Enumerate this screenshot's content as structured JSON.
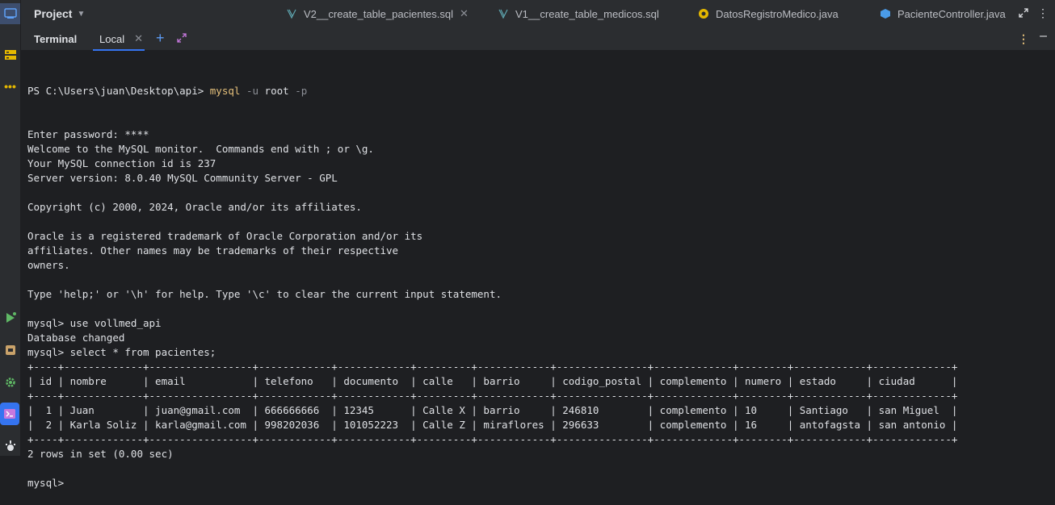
{
  "topbar": {
    "project_label": "Project",
    "tabs": [
      {
        "label": "V2__create_table_pacientes.sql",
        "icon": "sql-migration-icon",
        "closable": true
      },
      {
        "label": "V1__create_table_medicos.sql",
        "icon": "sql-migration-icon",
        "closable": false
      },
      {
        "label": "DatosRegistroMedico.java",
        "icon": "java-record-icon",
        "closable": false
      },
      {
        "label": "PacienteController.java",
        "icon": "java-class-icon",
        "closable": false
      }
    ]
  },
  "terminal_panel": {
    "title": "Terminal",
    "tab_label": "Local"
  },
  "terminal": {
    "prompt_line": {
      "prefix": "PS C:\\Users\\juan\\Desktop\\api> ",
      "command": "mysql",
      "flag1": "-u",
      "user": "root",
      "flag2": "-p"
    },
    "lines": [
      "Enter password: ****",
      "Welcome to the MySQL monitor.  Commands end with ; or \\g.",
      "Your MySQL connection id is 237",
      "Server version: 8.0.40 MySQL Community Server - GPL",
      "",
      "Copyright (c) 2000, 2024, Oracle and/or its affiliates.",
      "",
      "Oracle is a registered trademark of Oracle Corporation and/or its",
      "affiliates. Other names may be trademarks of their respective",
      "owners.",
      "",
      "Type 'help;' or '\\h' for help. Type '\\c' to clear the current input statement.",
      "",
      "mysql> use vollmed_api",
      "Database changed",
      "mysql> select * from pacientes;",
      "+----+-------------+-----------------+------------+------------+---------+------------+---------------+-------------+--------+------------+-------------+",
      "| id | nombre      | email           | telefono   | documento  | calle   | barrio     | codigo_postal | complemento | numero | estado     | ciudad      |",
      "+----+-------------+-----------------+------------+------------+---------+------------+---------------+-------------+--------+------------+-------------+",
      "|  1 | Juan        | juan@gmail.com  | 666666666  | 12345      | Calle X | barrio     | 246810        | complemento | 10     | Santiago   | san Miguel  |",
      "|  2 | Karla Soliz | karla@gmail.com | 998202036  | 101052223  | Calle Z | miraflores | 296633        | complemento | 16     | antofagsta | san antonio |",
      "+----+-------------+-----------------+------------+------------+---------+------------+---------------+-------------+--------+------------+-------------+",
      "2 rows in set (0.00 sec)",
      "",
      "mysql>"
    ]
  },
  "colors": {
    "background": "#1e1f22",
    "chrome": "#2b2d30",
    "accent": "#3574f0",
    "command": "#e5c07b",
    "text": "#dfe1e5"
  }
}
